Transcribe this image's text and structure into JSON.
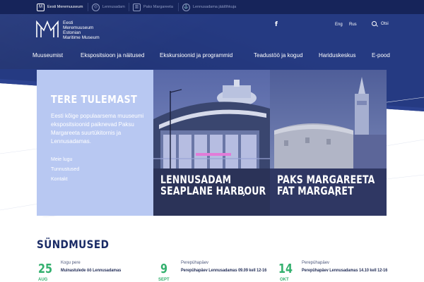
{
  "topbar": {
    "sites": [
      {
        "label": "Eesti Meremuuseum",
        "glyph": "M"
      },
      {
        "label": "Lennusadam",
        "glyph": "◎"
      },
      {
        "label": "Paks Margareeta",
        "glyph": "▥"
      },
      {
        "label": "Lennusadama jäälõhkuja",
        "glyph": "⚓"
      }
    ]
  },
  "header": {
    "brand_lines": [
      "Eesti",
      "Meremuuseum",
      "Estonian",
      "Maritime Museum"
    ],
    "facebook": "f",
    "lang": [
      "Eng",
      "Rus"
    ],
    "search_label": "Otsi"
  },
  "nav": {
    "items": [
      "Muuseumist",
      "Ekspositsioon ja näitused",
      "Ekskursioonid ja programmid",
      "Teadustöö ja kogud",
      "Hariduskeskus",
      "E-pood"
    ]
  },
  "welcome": {
    "title": "TERE TULEMAST",
    "description": "Eesti kõige populaarsema muuseumi ekspositsioonid paiknevad Paksu Margareeta suurtükitornis ja Lennusadamas.",
    "links": [
      "Meie lugu",
      "Tunnustused",
      "Kontakt"
    ]
  },
  "cards": [
    {
      "title_line1": "LENNUSADAM",
      "title_line2": "SEAPLANE HARBOUR",
      "arrow": "›"
    },
    {
      "title_line1": "PAKS MARGAREETA",
      "title_line2": "FAT MARGARET",
      "arrow": "›"
    }
  ],
  "events": {
    "title": "SÜNDMUSED",
    "items": [
      {
        "day": "25",
        "month": "AUG",
        "category": "Kogu pere",
        "title": "Muinastulede öö Lennusadamas"
      },
      {
        "day": "9",
        "month": "SEPT",
        "category": "Perepühapäev",
        "title": "Perepühapäev Lennusadamas 09.09 kell 12-16"
      },
      {
        "day": "14",
        "month": "OKT",
        "category": "Perepühapäev",
        "title": "Perepühapäev Lennusadamas 14.10 kell 12-16"
      }
    ]
  },
  "colors": {
    "header_bg": "#253a82",
    "topbar_bg": "#16245a",
    "welcome_bg": "#b8c8f2",
    "accent_green": "#33b06e"
  }
}
